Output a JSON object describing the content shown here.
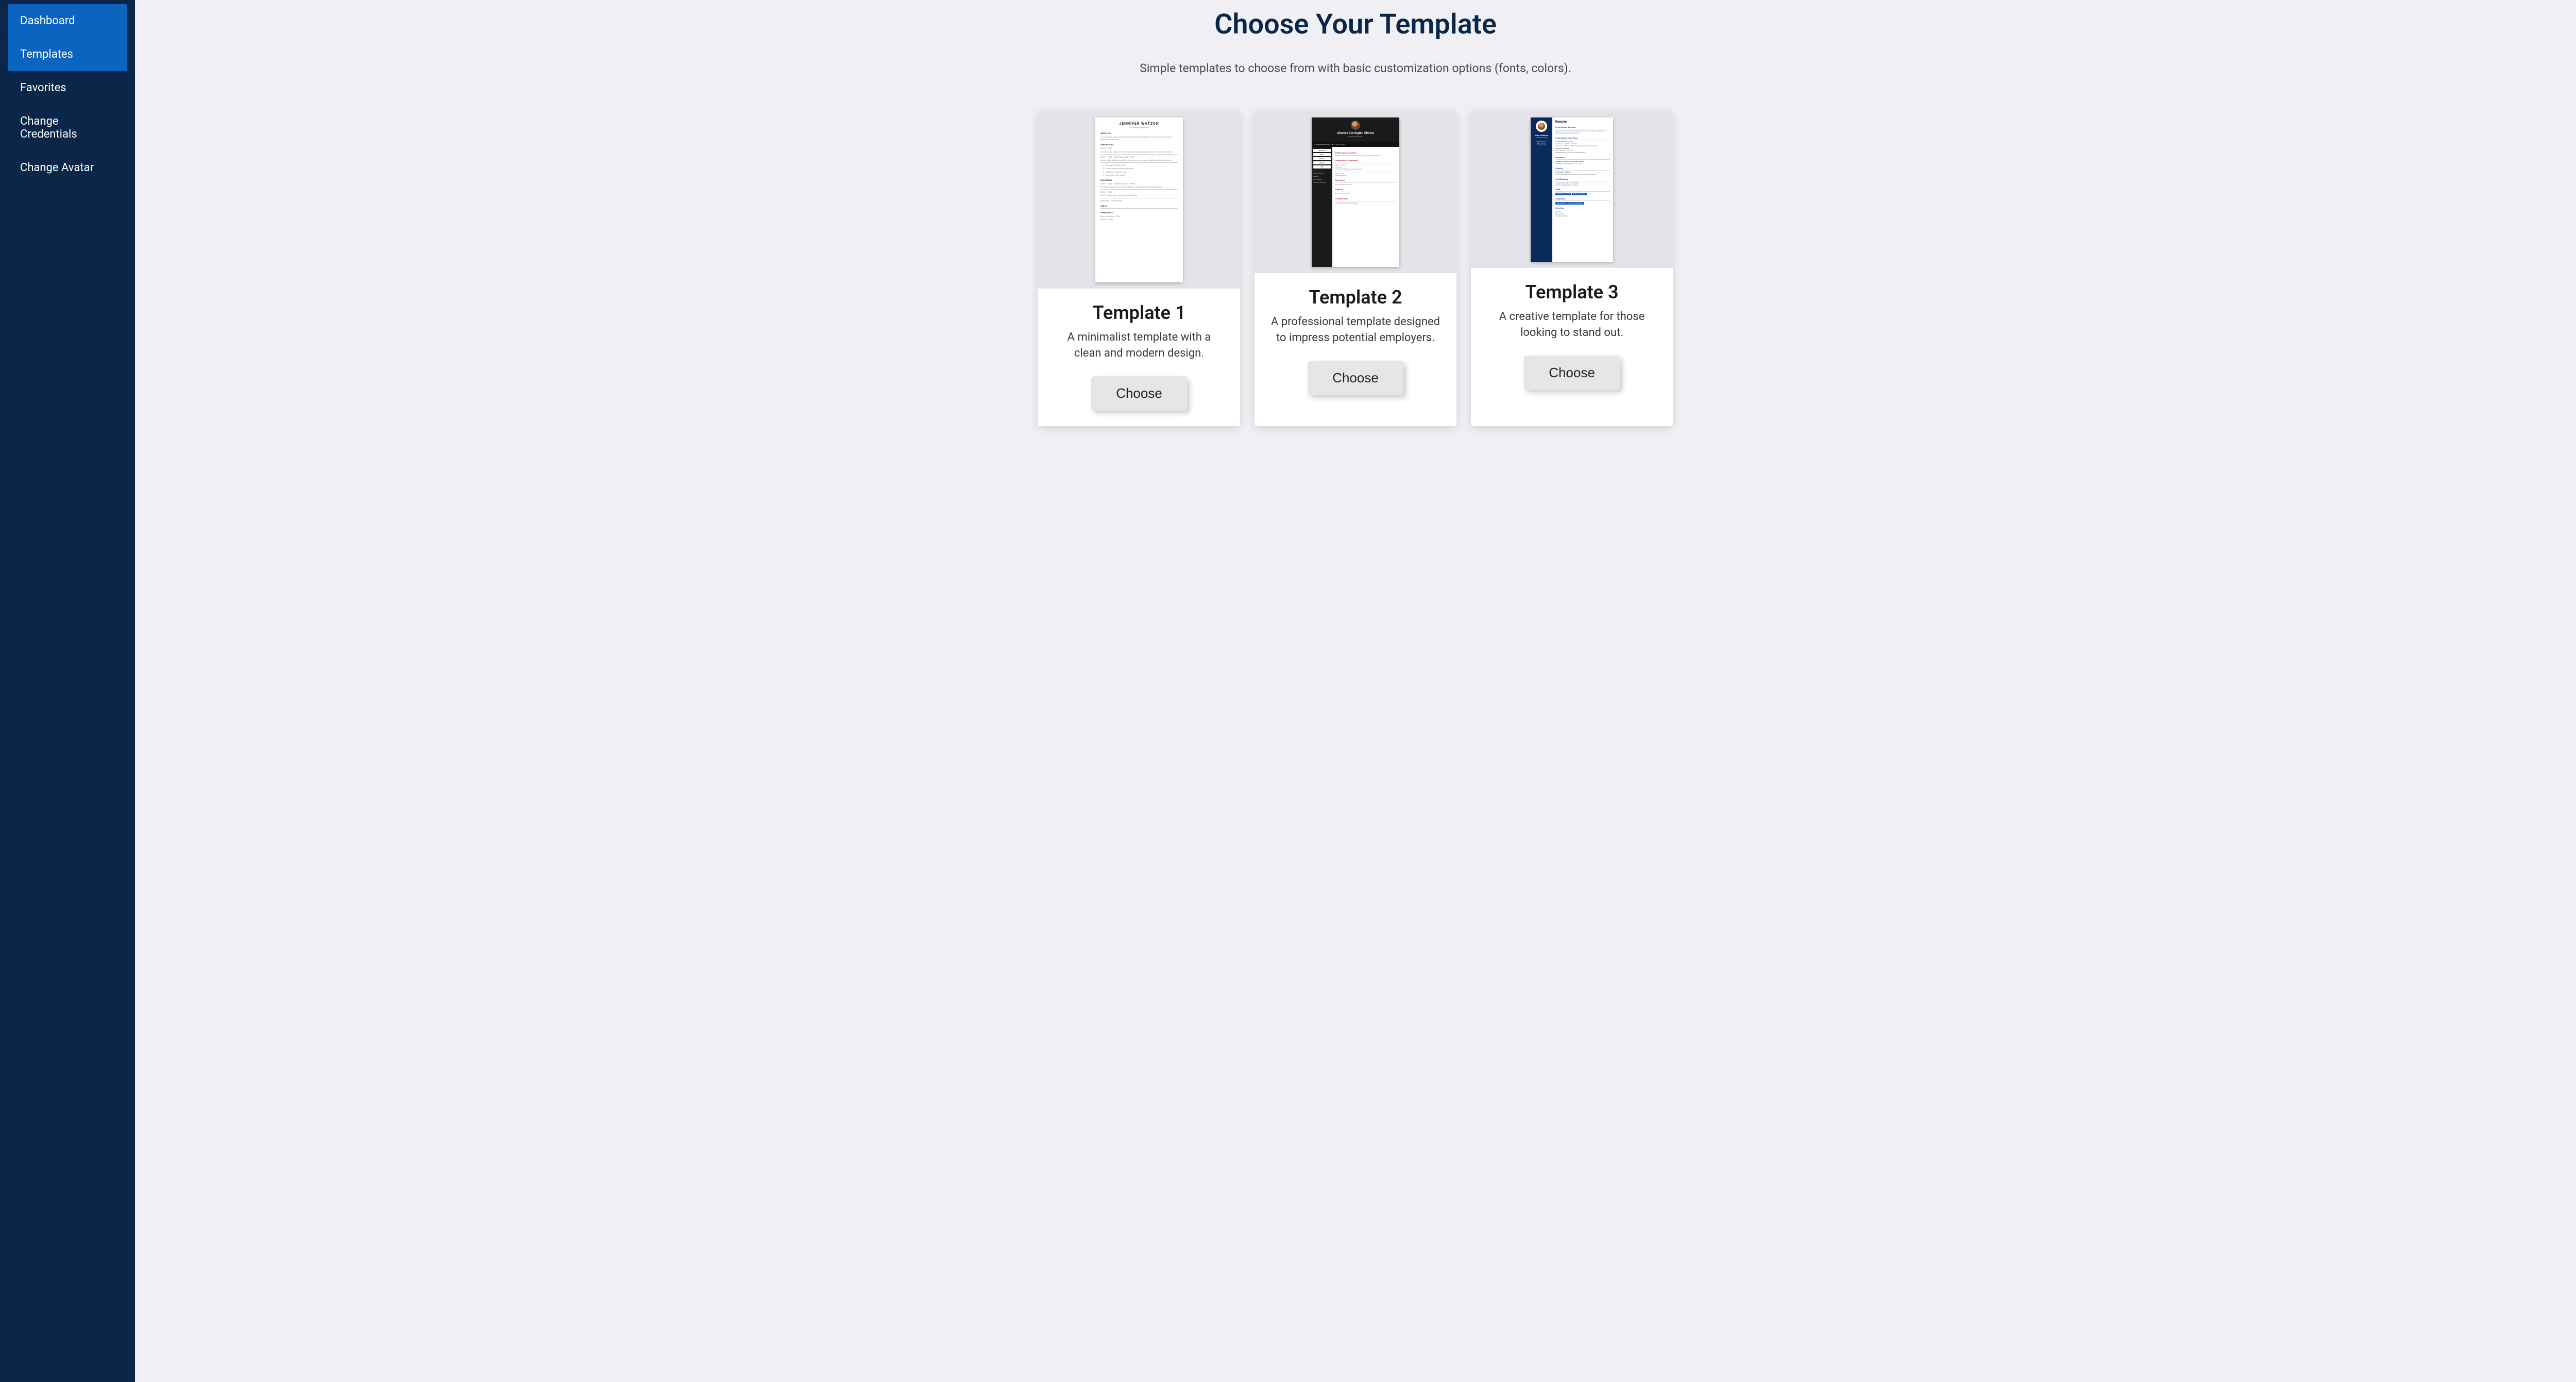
{
  "sidebar": {
    "items": [
      {
        "label": "Dashboard",
        "active": true
      },
      {
        "label": "Templates",
        "active": true
      },
      {
        "label": "Favorites",
        "active": false
      },
      {
        "label": "Change Credentials",
        "active": false
      },
      {
        "label": "Change Avatar",
        "active": false
      }
    ]
  },
  "page": {
    "title": "Choose Your Template",
    "subtitle": "Simple templates to choose from with basic customization options (fonts, colors)."
  },
  "templates": [
    {
      "title": "Template 1",
      "description": "A minimalist template with a clean and modern design.",
      "choose_label": "Choose",
      "preview": {
        "name": "JENNIFER WATSON",
        "role_sub": "USER EXPERIENCE DESIGNER",
        "sections": [
          "ABOUT ME",
          "EXPERIENCES",
          "EDUCATION",
          "SKILLS",
          "REFERENCES"
        ]
      }
    },
    {
      "title": "Template 2",
      "description": "A professional template designed to impress potential employers.",
      "choose_label": "Choose",
      "preview": {
        "name": "Abakwe Carrington Obinna",
        "role": "Full Stack Developer",
        "sections": [
          "Professional Summary",
          "Professional Experience",
          "Education",
          "Projects",
          "Certifications"
        ]
      }
    },
    {
      "title": "Template 3",
      "description": "A creative template for those looking to stand out.",
      "choose_label": "Choose",
      "preview": {
        "name": "Alex Johnson",
        "role": "Full Stack Developer",
        "heading": "Resume",
        "sections": [
          "Professional Summary",
          "Professional Experience",
          "Education",
          "Projects",
          "Certifications",
          "Skills",
          "Languages",
          "Interests"
        ],
        "skills": [
          "JavaScript",
          "React",
          "Node.js",
          "Python"
        ]
      }
    }
  ]
}
